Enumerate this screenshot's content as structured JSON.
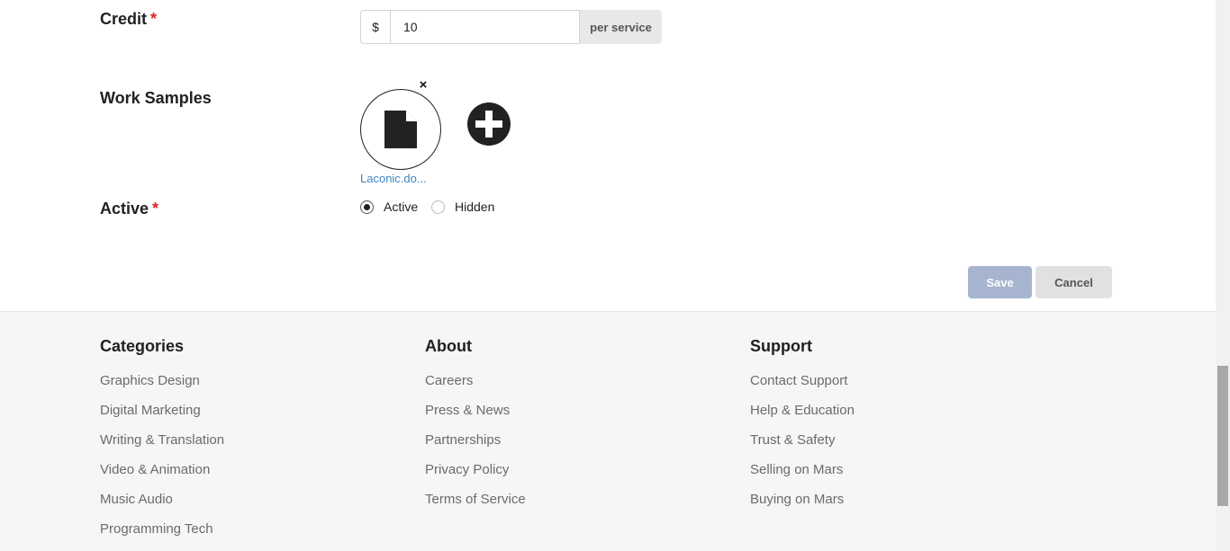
{
  "form": {
    "credit": {
      "label": "Credit",
      "required_mark": "*",
      "prefix": "$",
      "value": "10",
      "suffix": "per service"
    },
    "work_samples": {
      "label": "Work Samples",
      "remove_glyph": "×",
      "file_name": "Laconic.do...",
      "file_icon": "file-icon",
      "add_icon": "plus-circle-icon"
    },
    "active": {
      "label": "Active",
      "required_mark": "*",
      "options": [
        {
          "label": "Active",
          "checked": true
        },
        {
          "label": "Hidden",
          "checked": false
        }
      ]
    },
    "save_label": "Save",
    "cancel_label": "Cancel"
  },
  "footer": {
    "columns": [
      {
        "title": "Categories",
        "links": [
          "Graphics Design",
          "Digital Marketing",
          "Writing & Translation",
          "Video & Animation",
          "Music Audio",
          "Programming Tech"
        ]
      },
      {
        "title": "About",
        "links": [
          "Careers",
          "Press & News",
          "Partnerships",
          "Privacy Policy",
          "Terms of Service"
        ]
      },
      {
        "title": "Support",
        "links": [
          "Contact Support",
          "Help & Education",
          "Trust & Safety",
          "Selling on Mars",
          "Buying on Mars"
        ]
      }
    ]
  },
  "colors": {
    "required": "#db2828",
    "link": "#4183c4",
    "save_disabled": "#a6b4cf",
    "footer_bg": "#f6f6f6"
  }
}
